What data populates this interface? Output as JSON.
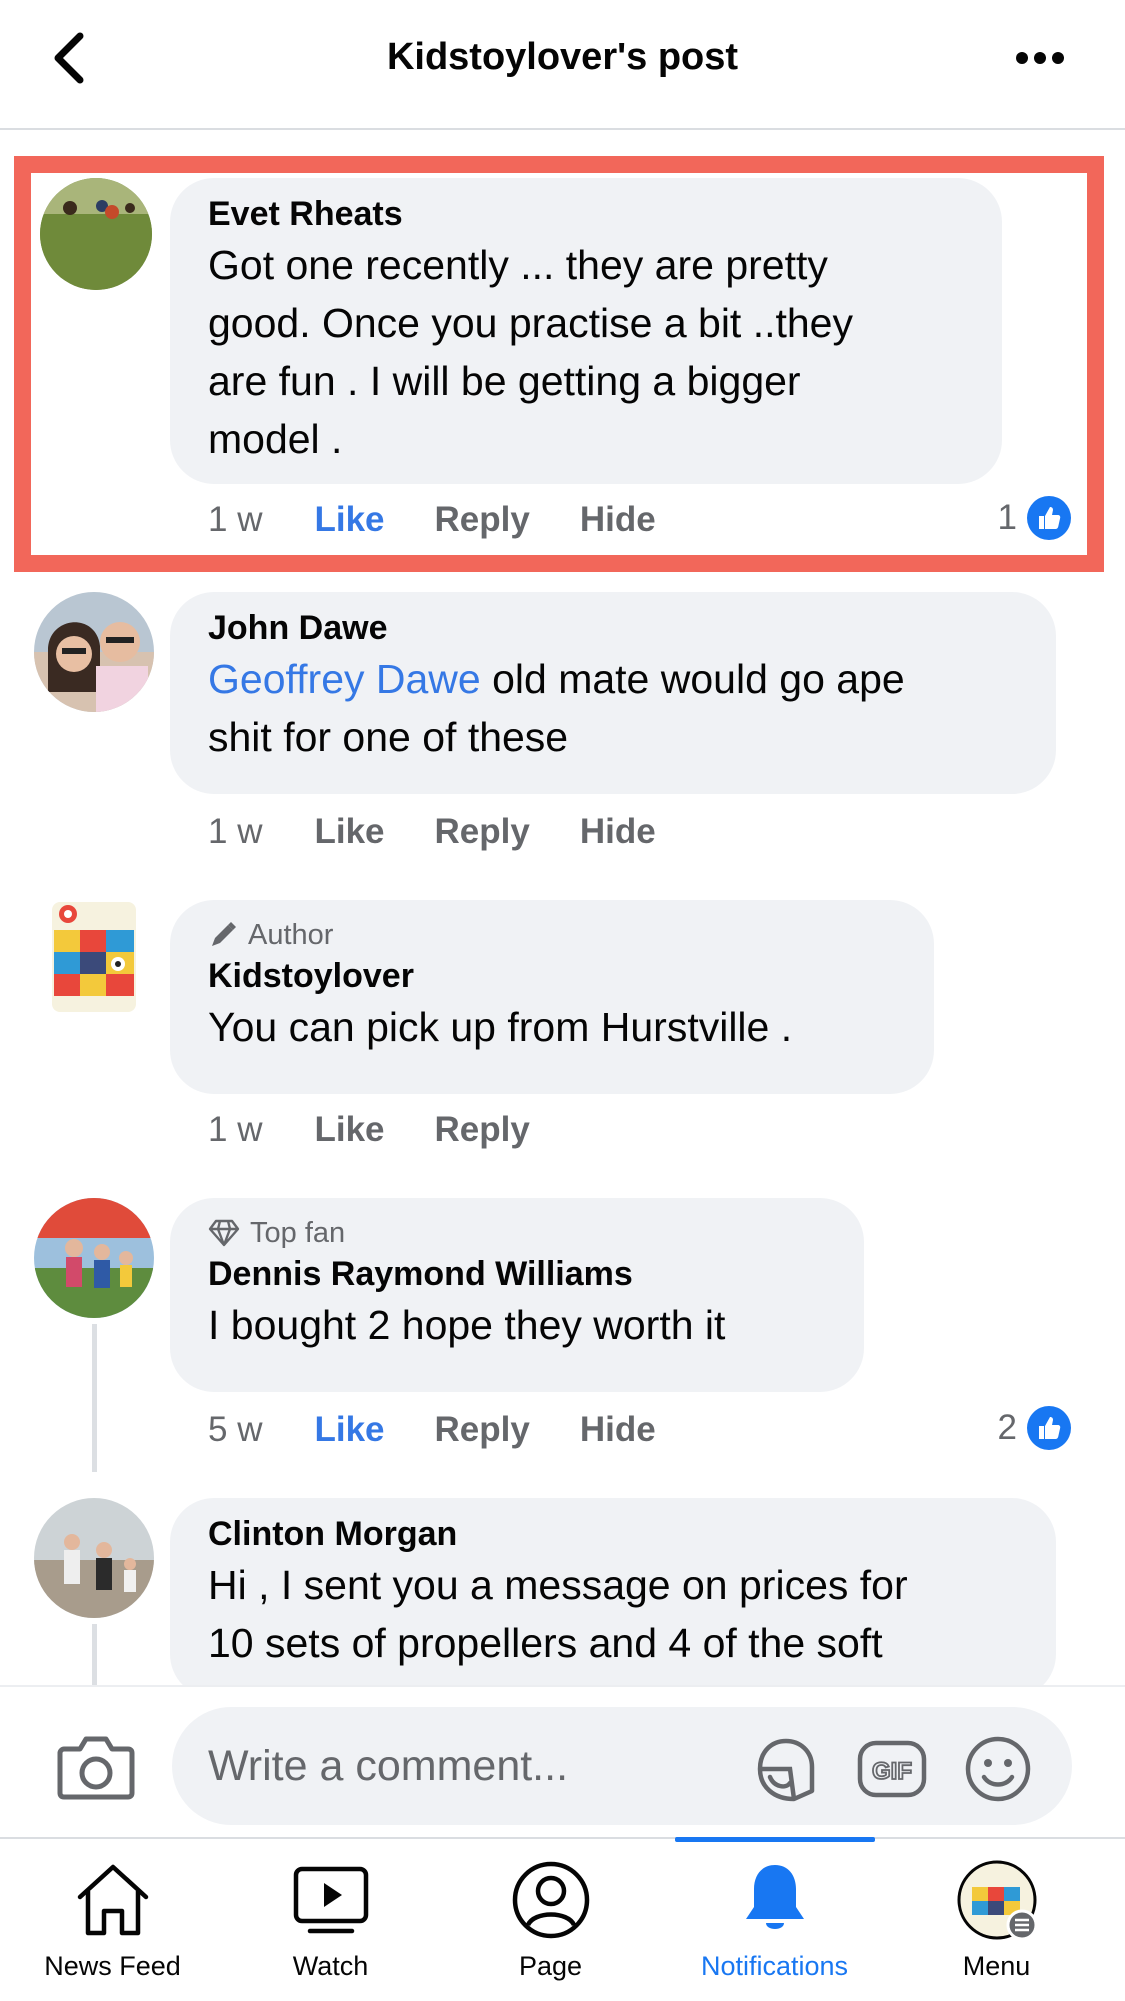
{
  "header": {
    "title": "Kidstoylover's post",
    "back_icon": "chevron-left-icon",
    "more_icon": "more-dots-icon"
  },
  "comments": [
    {
      "name": "Evet Rheats",
      "text": "Got one recently ... they are pretty good. Once you practise a bit ..they are fun . I will be getting a bigger model .",
      "lines": [
        "Got one recently ... they are pretty",
        "good. Once you practise a bit ..they",
        "are fun . I will be getting a bigger",
        "model ."
      ],
      "time": "1 w",
      "like": "Like",
      "reply": "Reply",
      "hide": "Hide",
      "reactions": "1",
      "liked": true,
      "highlighted": true
    },
    {
      "name": "John Dawe",
      "mention": "Geoffrey Dawe",
      "line1_rest": " old mate would go ape",
      "line2": "shit for one of these",
      "time": "1 w",
      "like": "Like",
      "reply": "Reply",
      "hide": "Hide"
    },
    {
      "badge": "Author",
      "badge_icon": "pen-icon",
      "name": "Kidstoylover",
      "text": "You can pick up from Hurstville .",
      "time": "1 w",
      "like": "Like",
      "reply": "Reply"
    },
    {
      "badge": "Top fan",
      "badge_icon": "diamond-icon",
      "name": "Dennis Raymond Williams",
      "text": "I bought 2 hope they worth it",
      "time": "5 w",
      "like": "Like",
      "reply": "Reply",
      "hide": "Hide",
      "reactions": "2",
      "liked": true
    },
    {
      "name": "Clinton Morgan",
      "lines": [
        "Hi , I sent you a message on prices for",
        "10 sets of propellers and 4 of the soft"
      ]
    }
  ],
  "composer": {
    "placeholder": "Write a comment...",
    "camera_icon": "camera-icon",
    "sticker_icon": "sticker-icon",
    "gif_icon": "gif-icon",
    "emoji_icon": "emoji-icon"
  },
  "tabs": [
    {
      "label": "News Feed",
      "icon": "home-icon"
    },
    {
      "label": "Watch",
      "icon": "video-icon"
    },
    {
      "label": "Page",
      "icon": "profile-icon"
    },
    {
      "label": "Notifications",
      "icon": "bell-icon",
      "active": true
    },
    {
      "label": "Menu",
      "icon": "menu-avatar-icon"
    }
  ],
  "colors": {
    "accent": "#1877f2",
    "link": "#3578e5",
    "bubble": "#f0f2f5",
    "highlight": "#f2675a",
    "secondary_text": "#65676b"
  }
}
